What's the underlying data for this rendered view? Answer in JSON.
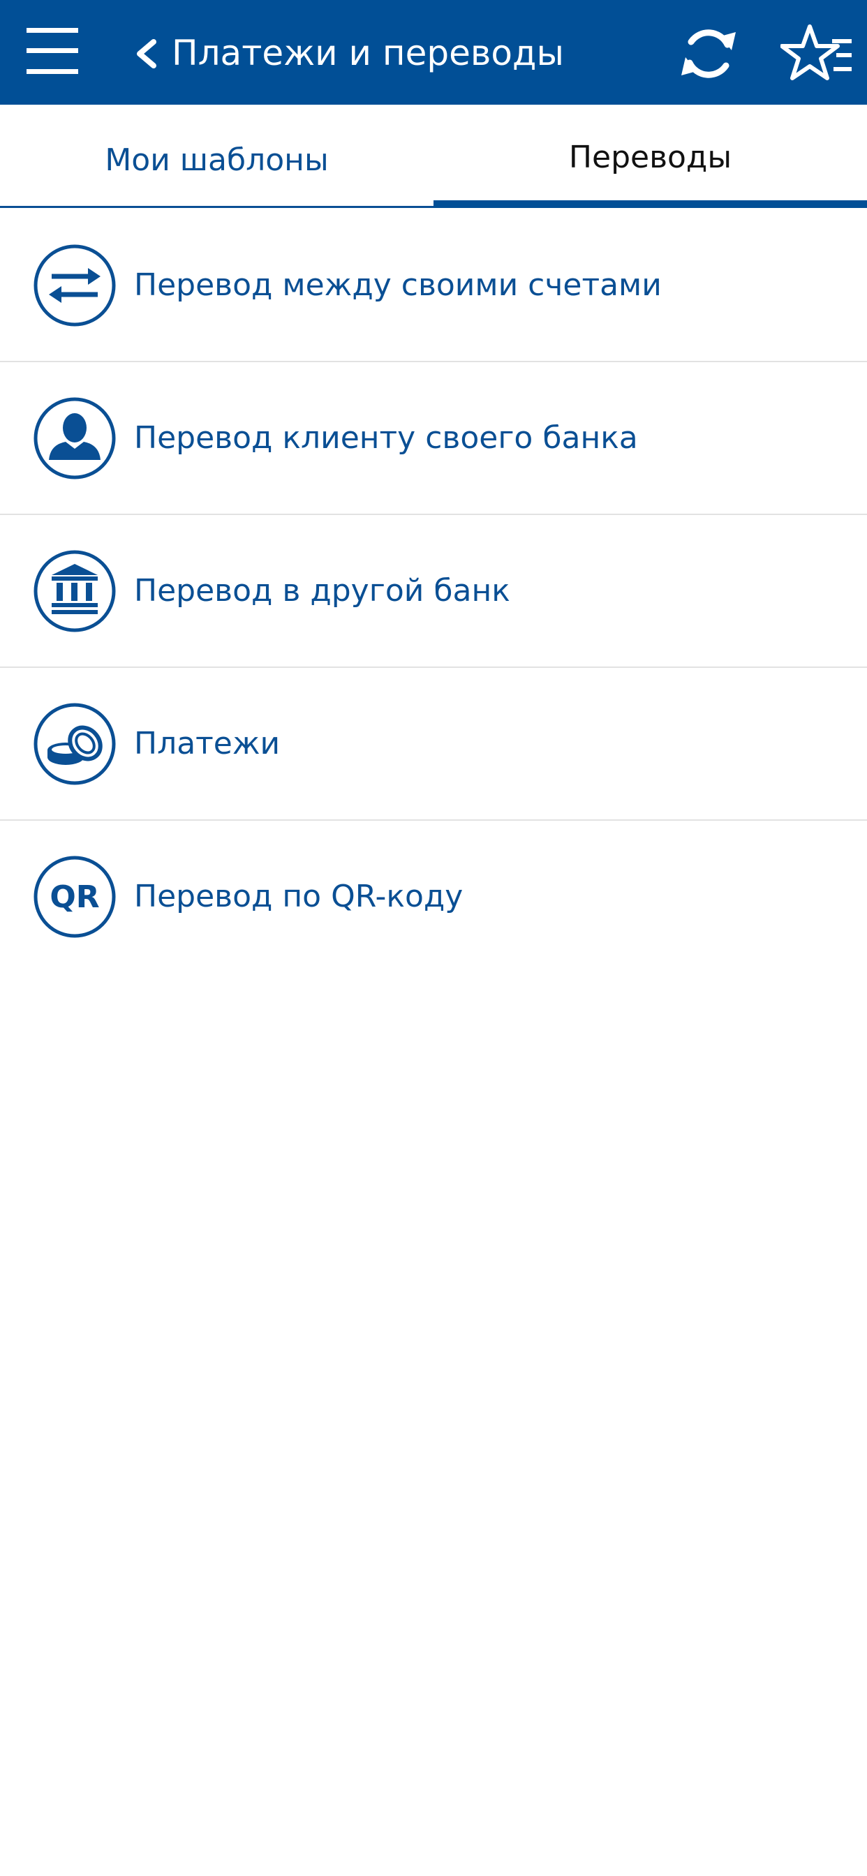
{
  "header": {
    "title": "Платежи и переводы",
    "menu_icon": "hamburger-menu-icon",
    "back_icon": "chevron-left-icon",
    "refresh_icon": "refresh-icon",
    "favorites_icon": "star-list-icon"
  },
  "tabs": [
    {
      "label": "Мои шаблоны",
      "active": false
    },
    {
      "label": "Переводы",
      "active": true
    }
  ],
  "transfers": [
    {
      "label": "Перевод между своими счетами",
      "icon": "swap-arrows-icon"
    },
    {
      "label": "Перевод клиенту своего банка",
      "icon": "person-icon"
    },
    {
      "label": "Перевод в другой банк",
      "icon": "bank-building-icon"
    },
    {
      "label": "Платежи",
      "icon": "coins-icon"
    },
    {
      "label": "Перевод по QR-коду",
      "icon": "qr-code-icon",
      "icon_text": "QR"
    }
  ],
  "colors": {
    "header_bg": "#014f96",
    "accent": "#0a4f94",
    "divider": "#e2e2e2",
    "active_tab_text": "#111111"
  }
}
